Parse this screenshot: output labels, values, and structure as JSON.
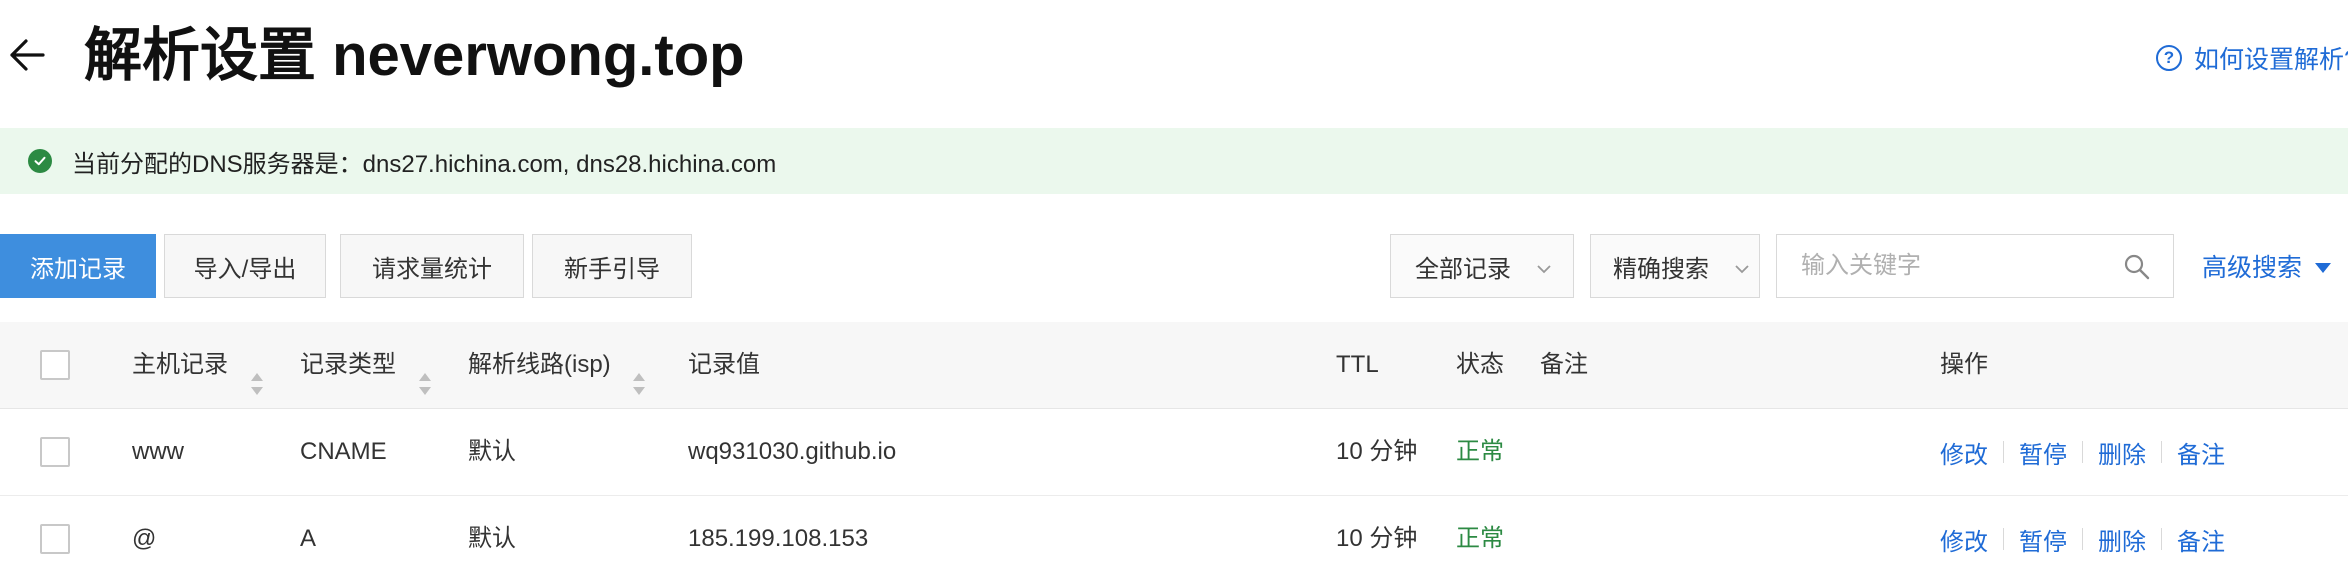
{
  "header": {
    "title": "解析设置 neverwong.top",
    "help_link": "如何设置解析?"
  },
  "notice": {
    "text": "当前分配的DNS服务器是：dns27.hichina.com, dns28.hichina.com"
  },
  "toolbar": {
    "add_record": "添加记录",
    "import_export": "导入/导出",
    "request_stats": "请求量统计",
    "beginner_guide": "新手引导",
    "filter_select": "全部记录",
    "search_mode": "精确搜索",
    "search_placeholder": "输入关键字",
    "advanced_search": "高级搜索"
  },
  "table": {
    "columns": {
      "host": "主机记录",
      "type": "记录类型",
      "line": "解析线路(isp)",
      "value": "记录值",
      "ttl": "TTL",
      "status": "状态",
      "remark": "备注",
      "actions": "操作"
    },
    "rows": [
      {
        "host": "www",
        "type": "CNAME",
        "line": "默认",
        "value": "wq931030.github.io",
        "ttl": "10 分钟",
        "status": "正常",
        "remark": "",
        "actions": {
          "edit": "修改",
          "pause": "暂停",
          "delete": "删除",
          "remark": "备注"
        }
      },
      {
        "host": "@",
        "type": "A",
        "line": "默认",
        "value": "185.199.108.153",
        "ttl": "10 分钟",
        "status": "正常",
        "remark": "",
        "actions": {
          "edit": "修改",
          "pause": "暂停",
          "delete": "删除",
          "remark": "备注"
        }
      }
    ]
  },
  "colors": {
    "primary": "#3e8ede",
    "link": "#1f6bd6",
    "success": "#2c8a43",
    "notice_bg": "#ebf8ed"
  },
  "icons": {
    "back": "arrow-left-icon",
    "help": "question-circle-icon",
    "notice": "check-circle-icon",
    "dropdown": "chevron-down-icon",
    "search": "search-icon",
    "advanced": "caret-down-icon",
    "sort": "sort-icon"
  }
}
